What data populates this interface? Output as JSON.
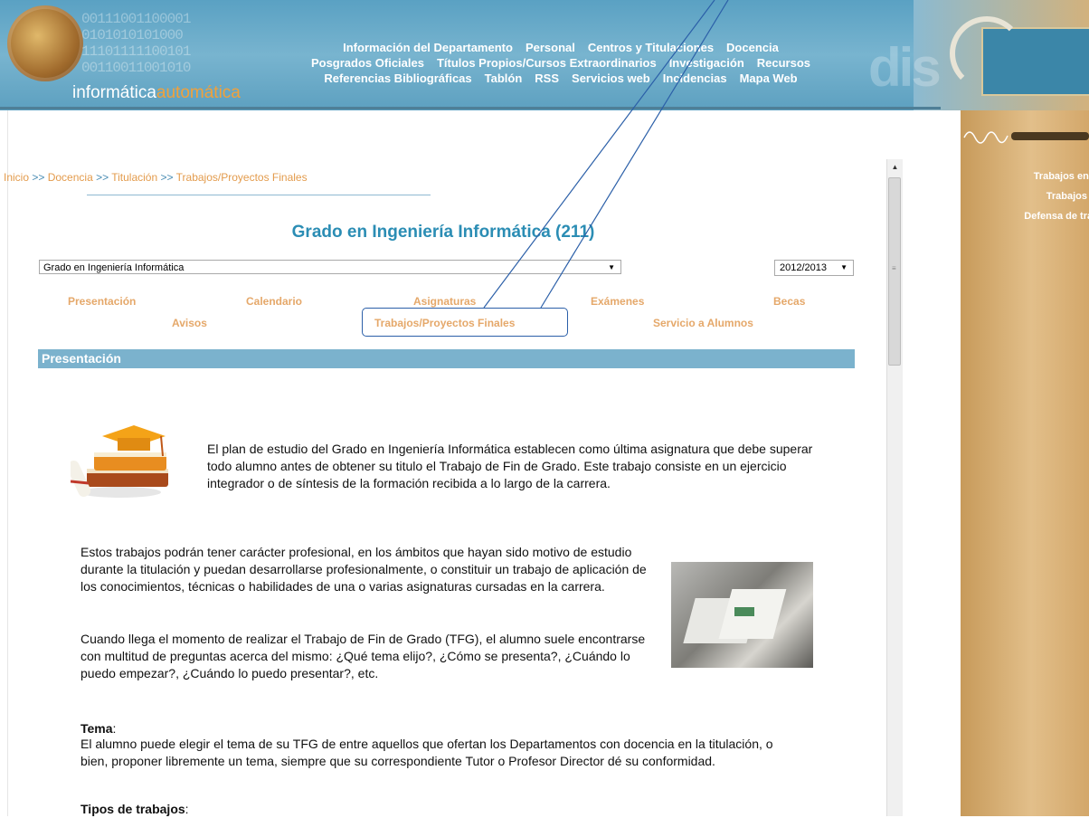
{
  "header": {
    "logo_binary": "00111001100001\n0101010101000\n11101111100101\n00110011001010",
    "logo_text_main": "informática",
    "logo_text_accent": "automática",
    "nav_rows": [
      [
        "Información del Departamento",
        "Personal",
        "Centros y Titulaciones",
        "Docencia"
      ],
      [
        "Posgrados Oficiales",
        "Títulos Propios/Cursos Extraordinarios",
        "Investigación",
        "Recursos"
      ],
      [
        "Referencias Bibliográficas",
        "Tablón",
        "RSS",
        "Servicios web",
        "Incidencias",
        "Mapa Web"
      ]
    ],
    "dis_text": "dis"
  },
  "sidebar": {
    "links": [
      "Trabajos en cur",
      "Trabajos leíd",
      "Defensa de trabaj"
    ]
  },
  "breadcrumb": {
    "items": [
      "Inicio",
      "Docencia",
      "Titulación",
      "Trabajos/Proyectos Finales"
    ],
    "separator": ">>"
  },
  "page_title": "Grado en Ingeniería Informática (211)",
  "degree_select": {
    "value": "Grado en Ingeniería Informática"
  },
  "year_select": {
    "value": "2012/2013"
  },
  "tabs": {
    "presentacion": "Presentación",
    "calendario": "Calendario",
    "asignaturas": "Asignaturas",
    "examenes": "Exámenes",
    "becas": "Becas",
    "avisos": "Avisos",
    "trabajos": "Trabajos/Proyectos Finales",
    "servicio": "Servicio a Alumnos"
  },
  "section_title": "Presentación",
  "paragraphs": {
    "intro": "El plan de estudio del Grado en Ingeniería Informática establecen como última asignatura que debe superar todo alumno antes de obtener su titulo el Trabajo de Fin de Grado. Este trabajo consiste en un ejercicio integrador o de síntesis de la formación recibida a lo largo de la carrera.",
    "p2": "Estos trabajos podrán tener carácter profesional, en los ámbitos que hayan sido motivo de estudio durante la titulación y puedan desarrollarse profesionalmente, o constituir un trabajo de aplicación de los conocimientos, técnicas o habilidades de una o varias asignaturas cursadas en la carrera.",
    "p3": "Cuando llega el momento de realizar el Trabajo de Fin de Grado (TFG), el alumno suele encontrarse con multitud de preguntas acerca del mismo: ¿Qué tema elijo?, ¿Cómo se presenta?, ¿Cuándo lo puedo empezar?, ¿Cuándo lo puedo presentar?, etc.",
    "tema_label": "Tema",
    "tema_colon": ":",
    "tema_text": "El alumno puede elegir el tema de su TFG de entre aquellos que ofertan los Departamentos con docencia en la titulación, o bien, proponer libremente un tema, siempre que su correspondiente Tutor o Profesor Director dé su conformidad.",
    "tipos_label": "Tipos de trabajos",
    "tipos_colon": ":"
  },
  "colors": {
    "header_blue": "#6aaccb",
    "accent_orange": "#e39b4c",
    "title_blue": "#2b8db4",
    "section_bar": "#7bb2cd",
    "annotation_blue": "#2b5fa8"
  }
}
